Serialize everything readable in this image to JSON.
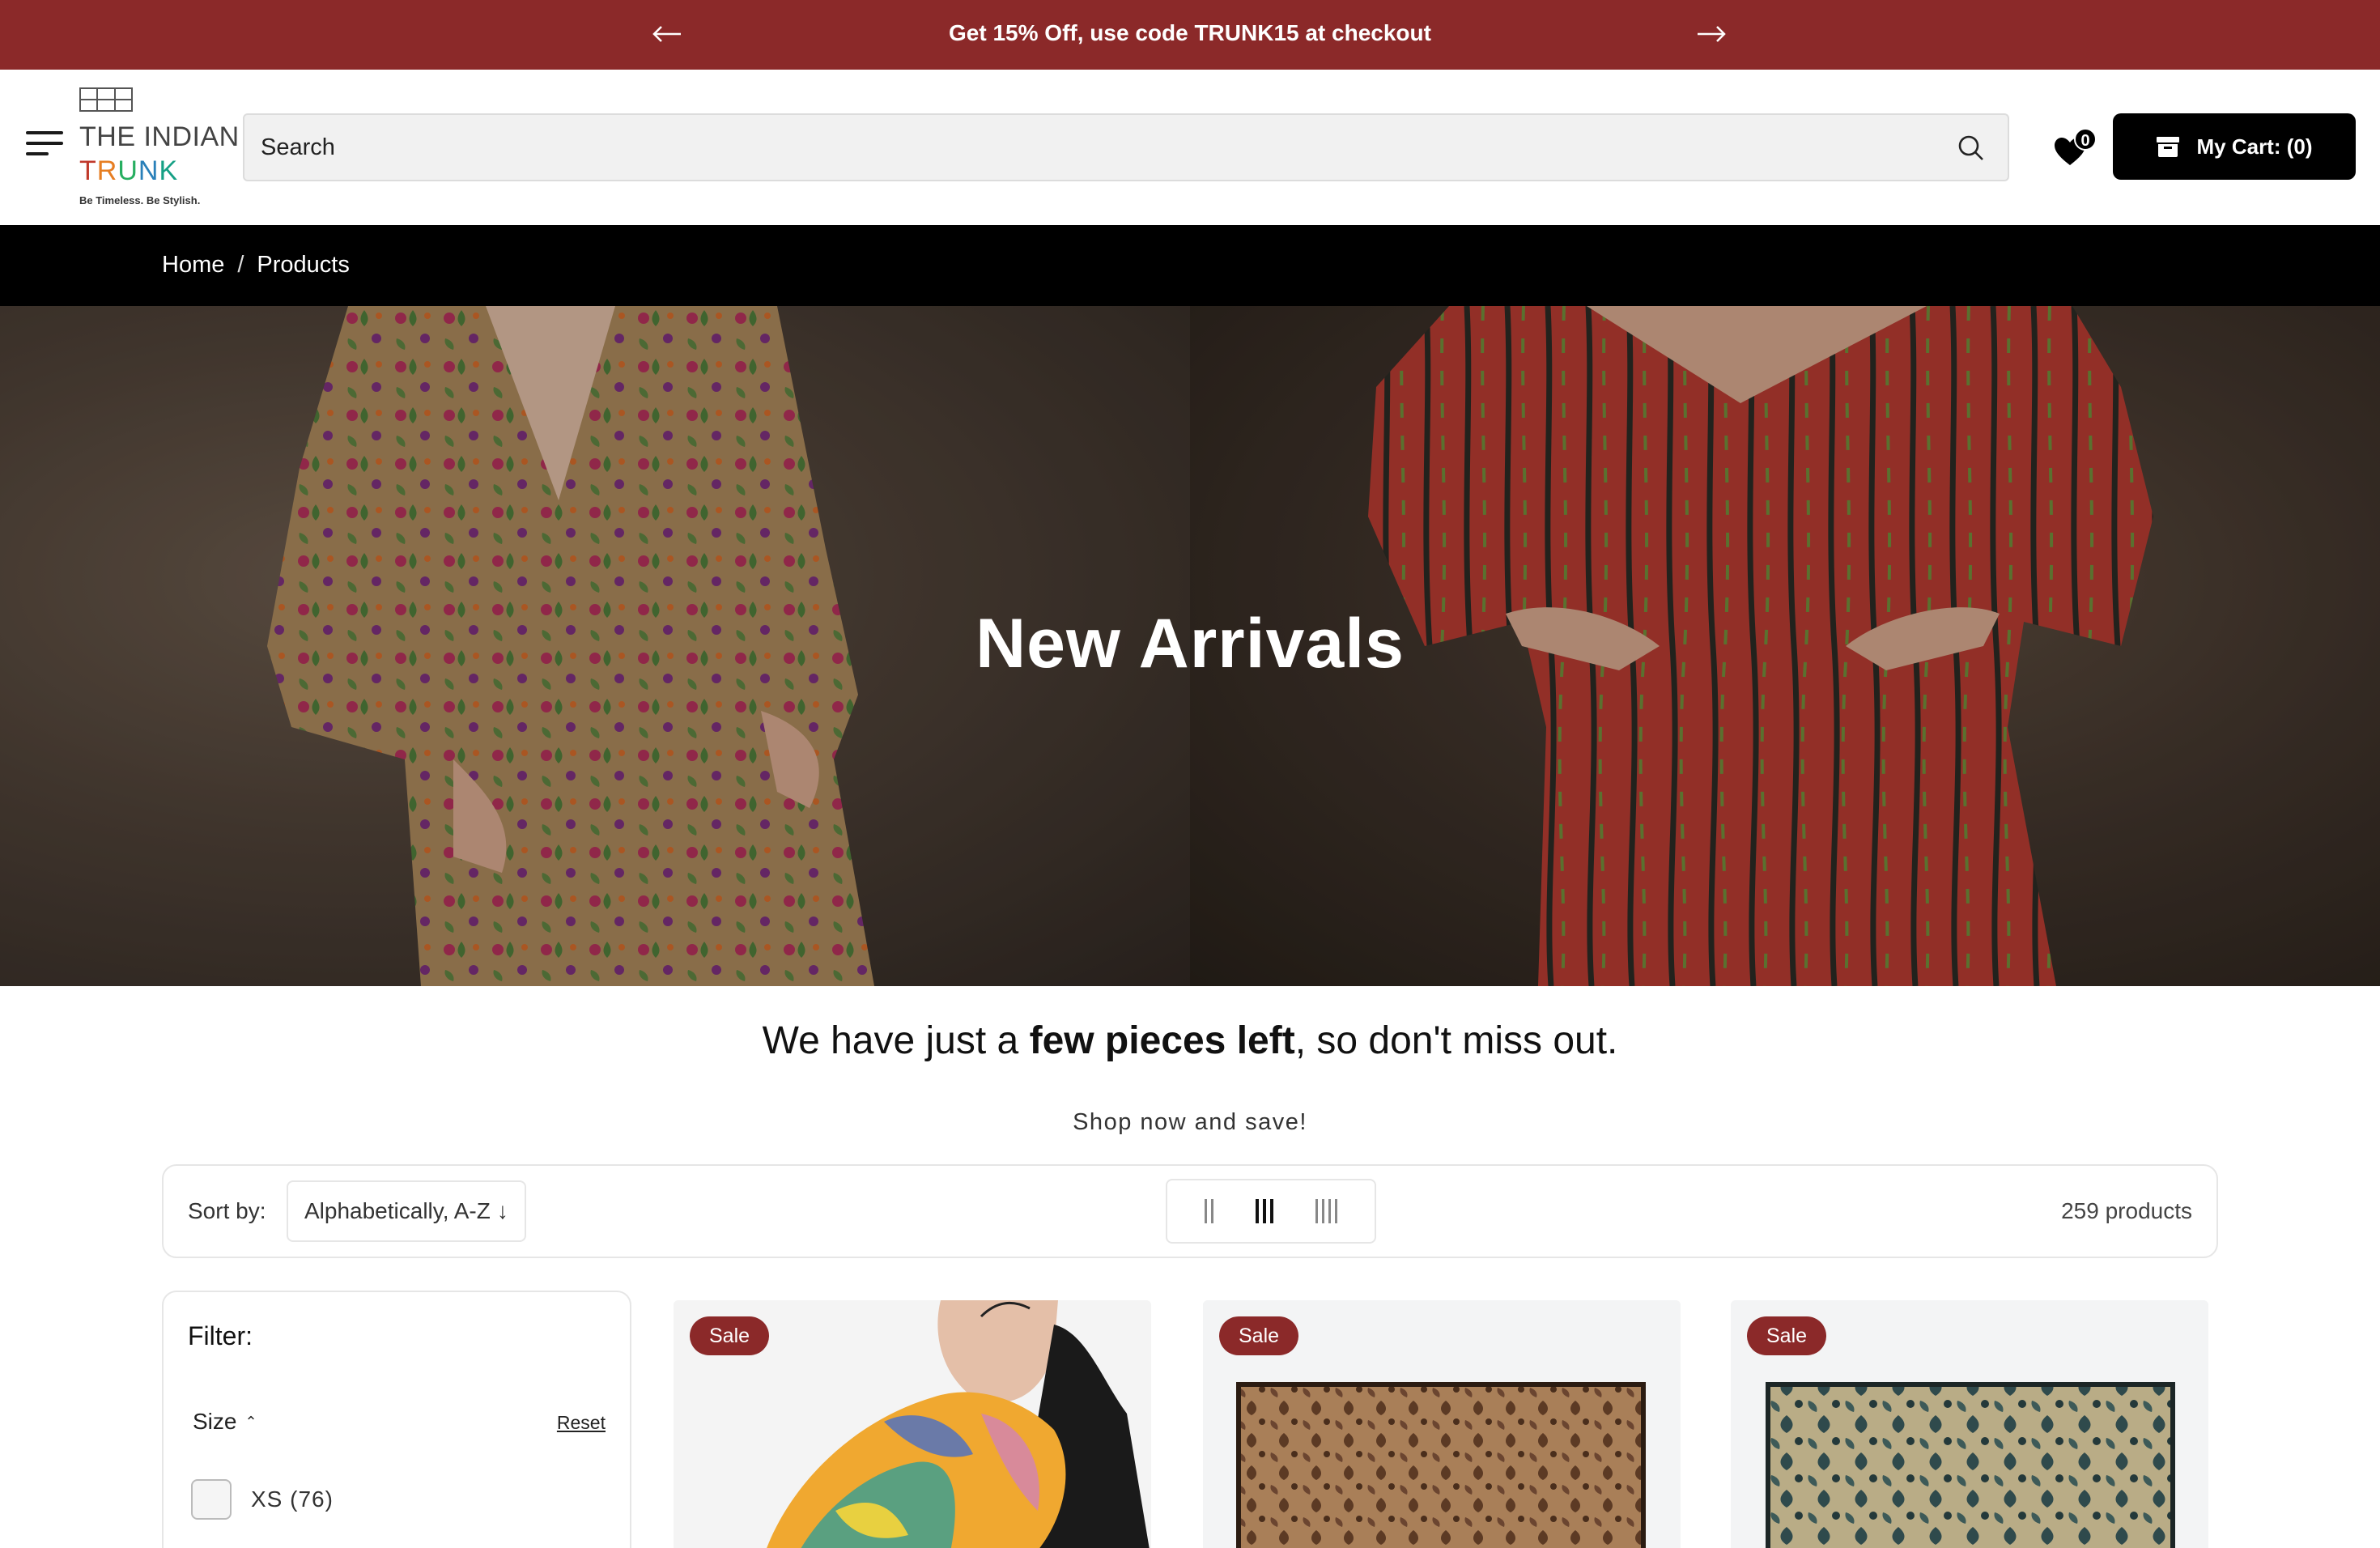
{
  "announcement": {
    "text": "Get 15% Off, use code TRUNK15 at checkout"
  },
  "brand": {
    "line1": "THE INDIAN",
    "line2": [
      "T",
      "R",
      "U",
      "N",
      "K"
    ],
    "tagline": "Be Timeless. Be Stylish."
  },
  "search": {
    "placeholder": "Search"
  },
  "wishlist": {
    "count": "0"
  },
  "cart": {
    "label": "My Cart: (0)"
  },
  "breadcrumb": {
    "home": "Home",
    "separator": "/",
    "current": "Products"
  },
  "hero": {
    "title": "New Arrivals"
  },
  "tagline": {
    "part1": "We have just a ",
    "bold": "few pieces left",
    "part2": ", so don't miss out."
  },
  "subline": "Shop now and save!",
  "toolbar": {
    "sort_label": "Sort by:",
    "sort_value": "Alphabetically, A-Z",
    "sort_arrow": "↓",
    "product_count": "259 products"
  },
  "filter": {
    "title": "Filter:",
    "group": "Size",
    "caret": "⌃",
    "reset": "Reset",
    "options": [
      {
        "label": "XS (76)"
      }
    ]
  },
  "products": [
    {
      "badge": "Sale"
    },
    {
      "badge": "Sale"
    },
    {
      "badge": "Sale"
    }
  ],
  "colors": {
    "accent": "#8b2929",
    "black": "#000000",
    "trunk": [
      "#c0392b",
      "#e67e22",
      "#27ae60",
      "#2980b9",
      "#8e44ad"
    ]
  }
}
